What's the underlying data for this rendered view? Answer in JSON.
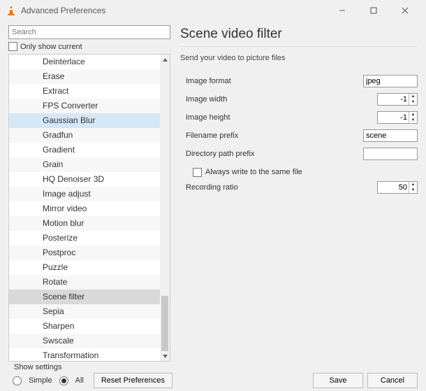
{
  "window": {
    "title": "Advanced Preferences"
  },
  "search": {
    "placeholder": "Search",
    "only_current": "Only show current"
  },
  "tree": {
    "items": [
      "Deinterlace",
      "Erase",
      "Extract",
      "FPS Converter",
      "Gaussian Blur",
      "Gradfun",
      "Gradient",
      "Grain",
      "HQ Denoiser 3D",
      "Image adjust",
      "Mirror video",
      "Motion blur",
      "Posterize",
      "Postproc",
      "Puzzle",
      "Rotate",
      "Scene filter",
      "Sepia",
      "Sharpen",
      "Swscale",
      "Transformation"
    ],
    "highlight_index": 4,
    "selected_index": 16
  },
  "panel": {
    "title": "Scene video filter",
    "subtitle": "Send your video to picture files",
    "image_format": {
      "label": "Image format",
      "value": "jpeg"
    },
    "image_width": {
      "label": "Image width",
      "value": "-1"
    },
    "image_height": {
      "label": "Image height",
      "value": "-1"
    },
    "filename_prefix": {
      "label": "Filename prefix",
      "value": "scene"
    },
    "dir_prefix": {
      "label": "Directory path prefix",
      "value": ""
    },
    "always_write": {
      "label": "Always write to the same file"
    },
    "recording_ratio": {
      "label": "Recording ratio",
      "value": "50"
    }
  },
  "footer": {
    "show_settings": "Show settings",
    "simple": "Simple",
    "all": "All",
    "reset": "Reset Preferences",
    "save": "Save",
    "cancel": "Cancel"
  }
}
